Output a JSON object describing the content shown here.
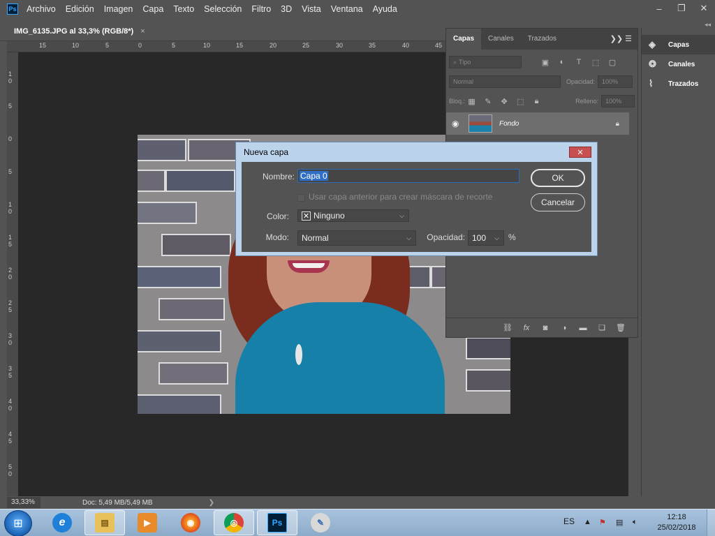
{
  "app": {
    "logo": "Ps",
    "menu": [
      "Archivo",
      "Edición",
      "Imagen",
      "Capa",
      "Texto",
      "Selección",
      "Filtro",
      "3D",
      "Vista",
      "Ventana",
      "Ayuda"
    ],
    "window_controls": [
      "minimize-icon",
      "restore-icon",
      "close-icon"
    ]
  },
  "document": {
    "tab_title": "IMG_6135.JPG al 33,3% (RGB/8*)",
    "tab_close": "×",
    "ruler_top": [
      "15",
      "10",
      "5",
      "0",
      "5",
      "10",
      "15",
      "20",
      "25",
      "30",
      "35",
      "40",
      "45"
    ],
    "ruler_left": [
      "1 0",
      "5",
      "0",
      "5",
      "1 0",
      "1 5",
      "2 0",
      "2 5",
      "3 0",
      "3 5",
      "4 0",
      "4 5",
      "5 0"
    ]
  },
  "status": {
    "zoom": "33,33%",
    "doc_info": "Doc: 5,49 MB/5,49 MB",
    "arrow": "❯"
  },
  "layers_panel": {
    "tabs": [
      "Capas",
      "Canales",
      "Trazados"
    ],
    "active_tab": "Capas",
    "menu_glyph": "❯❯  ☰",
    "filter_placeholder": "Tipo",
    "blend_mode": "Normal",
    "opacity_label": "Opacidad:",
    "opacity_value": "100%",
    "lock_label": "Bloq.:",
    "fill_label": "Relleno:",
    "fill_value": "100%",
    "layers": [
      {
        "name": "Fondo",
        "visible": true,
        "locked": true
      }
    ]
  },
  "dock": {
    "items": [
      {
        "label": "Capas",
        "icon": "layers-icon"
      },
      {
        "label": "Canales",
        "icon": "channels-icon"
      },
      {
        "label": "Trazados",
        "icon": "paths-icon"
      }
    ],
    "collapse": "◂◂"
  },
  "dialog": {
    "title": "Nueva capa",
    "close": "✕",
    "name_label": "Nombre:",
    "name_value": "Capa 0",
    "mask_label": "Usar capa anterior para crear máscara de recorte",
    "color_label": "Color:",
    "color_value": "Ninguno",
    "mode_label": "Modo:",
    "mode_value": "Normal",
    "opacity_label": "Opacidad:",
    "opacity_value": "100",
    "percent": "%",
    "ok": "OK",
    "cancel": "Cancelar"
  },
  "taskbar": {
    "apps": [
      {
        "name": "internet-explorer",
        "glyph": "e"
      },
      {
        "name": "file-explorer",
        "glyph": "▤"
      },
      {
        "name": "media-player",
        "glyph": "▶"
      },
      {
        "name": "firefox",
        "glyph": "◉"
      },
      {
        "name": "chrome",
        "glyph": "◎"
      },
      {
        "name": "photoshop",
        "glyph": "Ps"
      },
      {
        "name": "paint",
        "glyph": "✎"
      }
    ],
    "language": "ES",
    "time": "12:18",
    "date": "25/02/2018"
  },
  "colors": {
    "accent": "#31a8ff",
    "selection": "#2f6fc4",
    "dialog_frame": "#bcd3ec"
  }
}
